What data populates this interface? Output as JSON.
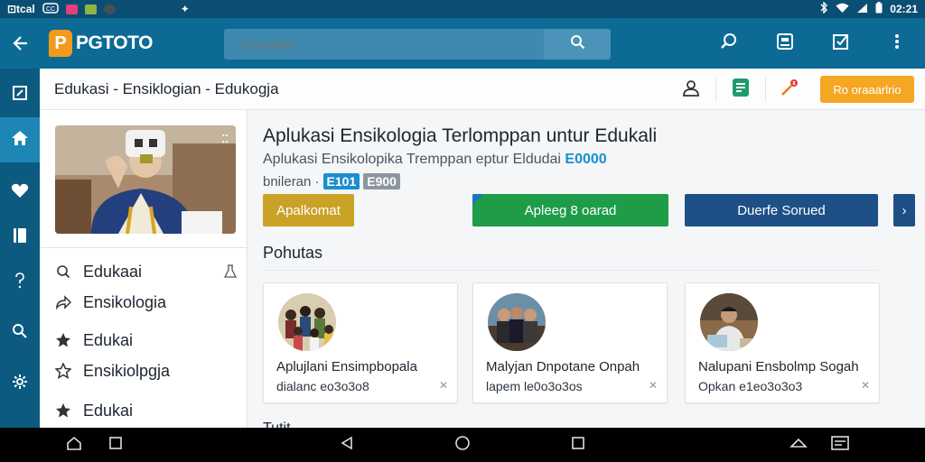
{
  "status_bar": {
    "carrier": "⊡tcal",
    "time": "02:21",
    "notification_icons": [
      "cc-icon",
      "app-icon-pink",
      "app-icon-green",
      "app-icon-dark",
      "sparkle-icon"
    ]
  },
  "app_bar": {
    "logo_text": "PGTOTO",
    "search_placeholder": "Emmdkan",
    "icons": [
      "search-icon",
      "scan-icon",
      "checkbox-icon",
      "more-vert-icon"
    ]
  },
  "rail": {
    "items": [
      "edit-icon",
      "home-icon",
      "heart-icon",
      "book-icon",
      "help-icon",
      "search-icon",
      "settings-icon"
    ],
    "active_index": 1
  },
  "breadcrumb": {
    "text": "Edukasi - Ensiklogian - Edukogja",
    "cta_label": "Ro oraaarlrio"
  },
  "left_panel": {
    "nav_items": [
      {
        "label": "Edukaai",
        "icon": "search-icon"
      },
      {
        "label": "Ensikologia",
        "icon": "share-icon"
      },
      {
        "label": "Edukai",
        "icon": "star-icon"
      },
      {
        "label": "Ensikiolpgja",
        "icon": "star-outline-icon"
      },
      {
        "label": "Edukai",
        "icon": "star-icon"
      }
    ]
  },
  "main": {
    "title": "Aplukasi Ensikologia Terlomppan untur Edukali",
    "subtitle": "Aplukasi Ensikolopika Tremppan eptur Eldudai",
    "subtitle_highlight": "E0000",
    "meta_prefix": "bnileran ·",
    "badge_1": "E101",
    "badge_2": "E900",
    "buttons": [
      "Apalkomat",
      "Apleeg 8 oarad",
      "Duerfe Sorued",
      "›"
    ],
    "section_title": "Pohutas",
    "cards": [
      {
        "title": "Aplujlani Ensimpbopala",
        "meta": "dialanc eo3o3o8"
      },
      {
        "title": "Malyjan Dnpotane Onpah",
        "meta": "lapem le0o3o3os"
      },
      {
        "title": "Nalupani Ensbolmp Sogah",
        "meta": "Opkan e1eo3o3o3"
      }
    ],
    "bottom_text": "Tutit"
  },
  "colors": {
    "status_bar": "#0a4f73",
    "app_bar": "#0d6a95",
    "rail": "#0c5a80",
    "accent_orange": "#f5a623",
    "button_gold": "#c9a227",
    "button_green": "#1f9c48",
    "button_navy": "#1e4f86"
  }
}
